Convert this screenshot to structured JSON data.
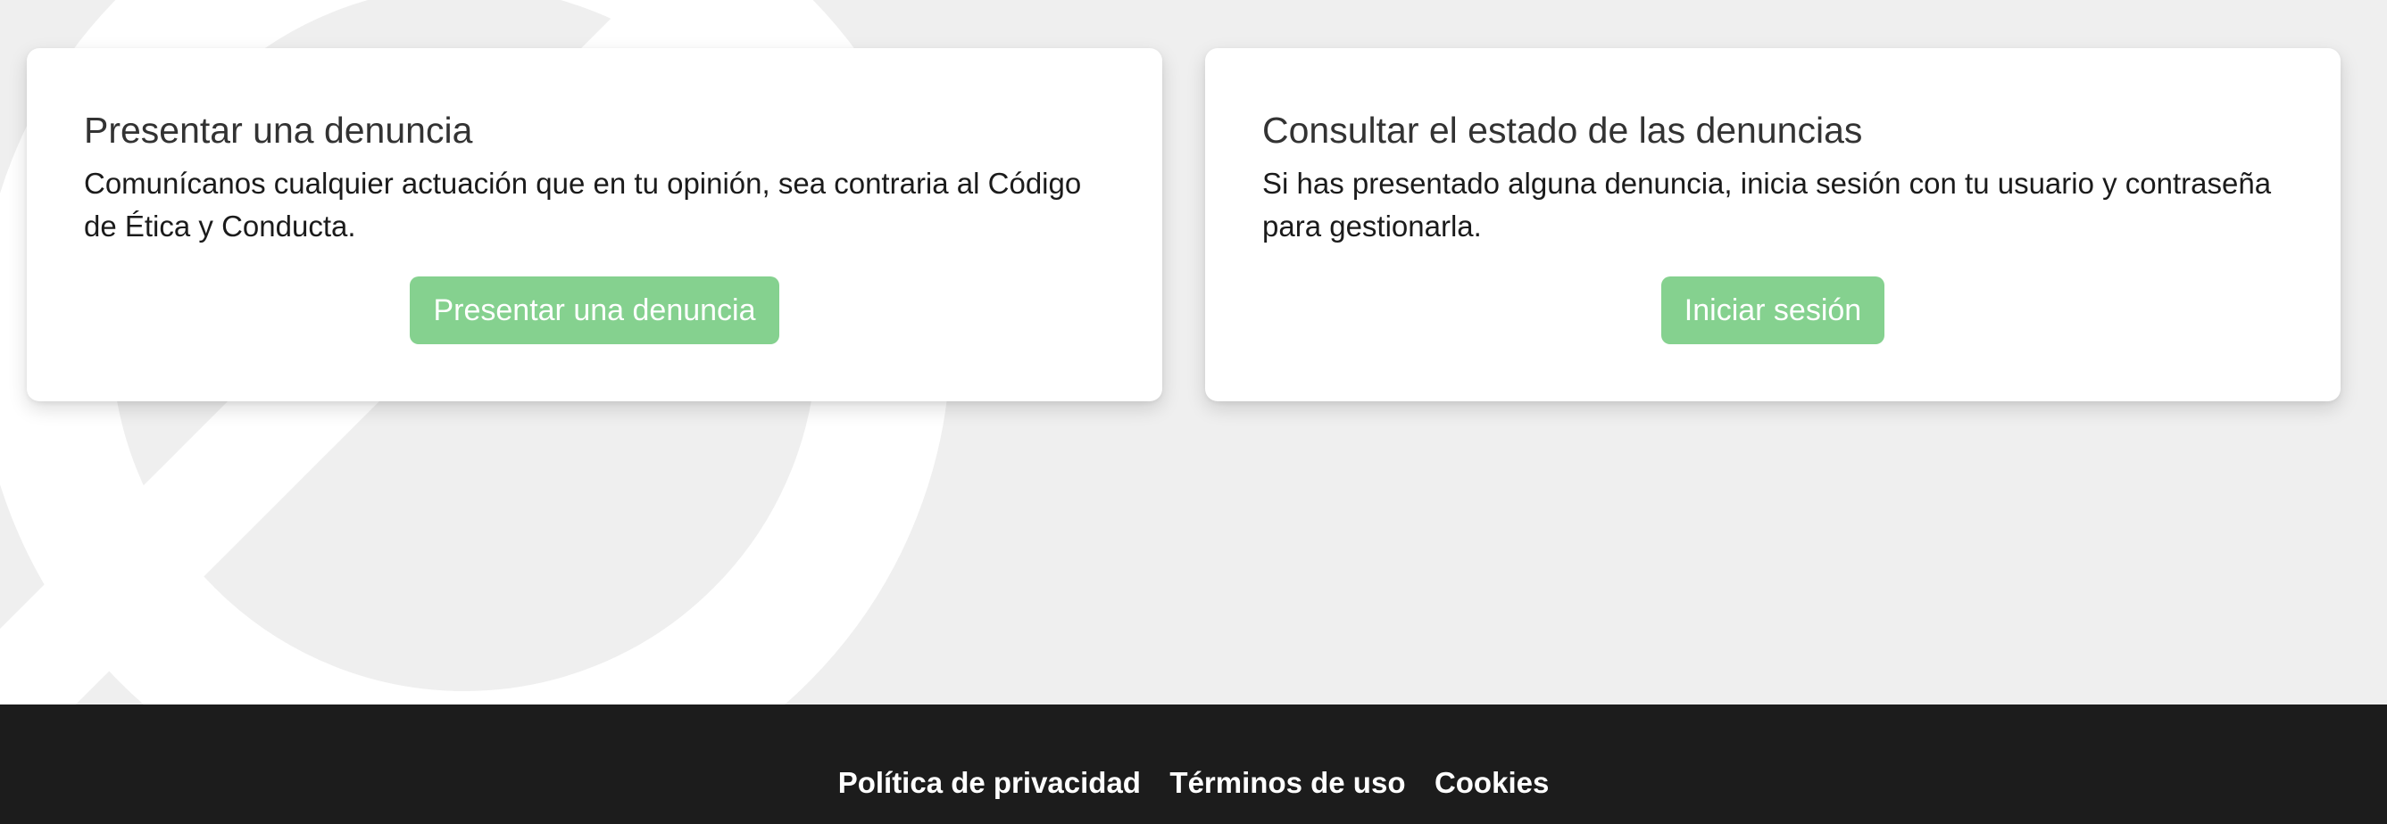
{
  "cards": [
    {
      "title": "Presentar una denuncia",
      "text": "Comunícanos cualquier actuación que en tu opinión, sea contraria al Código de Ética y Conducta.",
      "button_label": "Presentar una denuncia"
    },
    {
      "title": "Consultar el estado de las denuncias",
      "text": "Si has presentado alguna denuncia, inicia sesión con tu usuario y contraseña para gestionarla.",
      "button_label": "Iniciar sesión"
    }
  ],
  "footer": {
    "links": [
      "Política de privacidad",
      "Términos de uso",
      "Cookies"
    ]
  },
  "colors": {
    "background": "#efefef",
    "card": "#ffffff",
    "button": "#85d18f",
    "footer": "#1c1c1c",
    "emblem": "#ffffff"
  },
  "icons": {
    "background_emblem": "circle-slash-emblem"
  }
}
